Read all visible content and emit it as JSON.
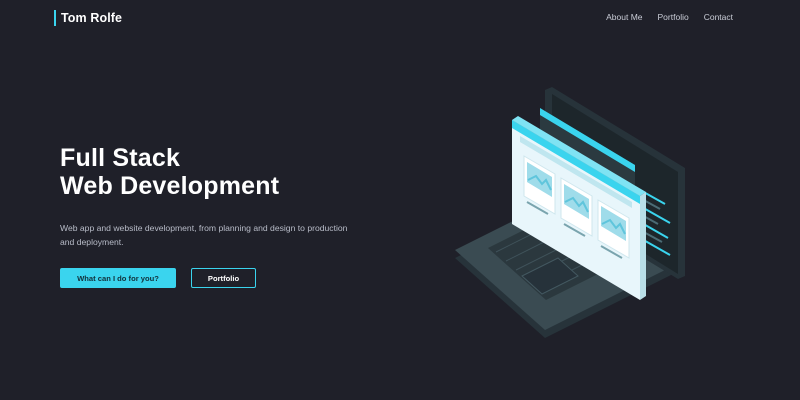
{
  "header": {
    "brand": "Tom Rolfe",
    "nav": [
      "About Me",
      "Portfolio",
      "Contact"
    ]
  },
  "hero": {
    "title_line1": "Full Stack",
    "title_line2": "Web Development",
    "subtitle_line1": "Web app and website development, from planning and design to production",
    "subtitle_line2": "and deployment.",
    "primary_button": "What can I do for you?",
    "secondary_button": "Portfolio"
  },
  "colors": {
    "background": "#1f2029",
    "accent": "#3ad4ee",
    "laptop": "#36474d",
    "laptop_dark": "#27333a"
  },
  "icons": [
    "laptop-illustration",
    "image-placeholder-icon"
  ]
}
